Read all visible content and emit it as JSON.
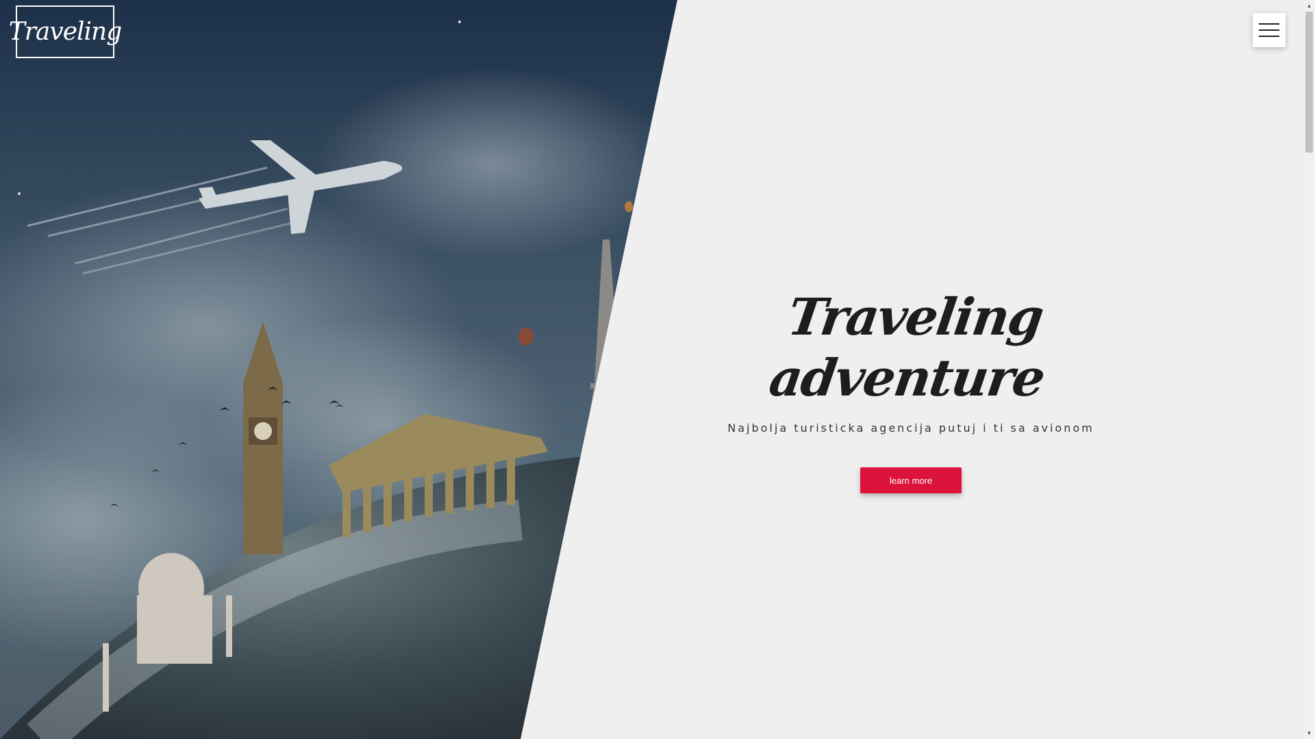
{
  "header": {
    "logo_text": "Traveling",
    "menu_icon": "hamburger-menu-icon"
  },
  "hero": {
    "title": "Traveling adventure",
    "subtitle": "Najbolja turisticka agencija putuj i ti sa avionom",
    "button_label": "learn more"
  },
  "colors": {
    "accent": "#dc143c",
    "background": "#efefef",
    "sky_dark": "#1f3550"
  },
  "scrollbar": {
    "up_icon": "scroll-up-arrow-icon",
    "down_icon": "scroll-down-arrow-icon",
    "position": 0
  }
}
